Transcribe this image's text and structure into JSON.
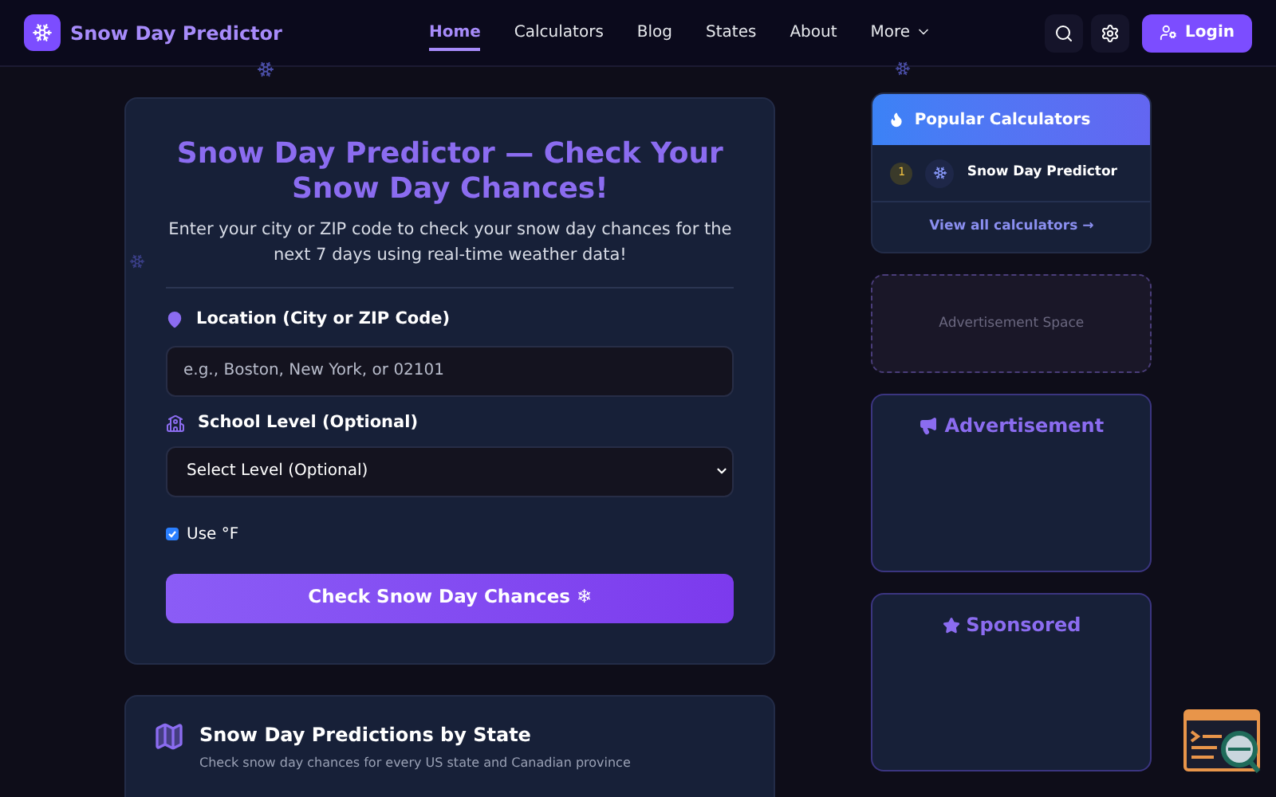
{
  "brand": {
    "name": "Snow Day Predictor"
  },
  "nav": [
    {
      "label": "Home",
      "selected": true
    },
    {
      "label": "Calculators",
      "selected": false
    },
    {
      "label": "Blog",
      "selected": false
    },
    {
      "label": "States",
      "selected": false
    },
    {
      "label": "About",
      "selected": false
    },
    {
      "label": "More",
      "selected": false,
      "kind": "dropdown"
    }
  ],
  "login": "Login",
  "form": {
    "title": "Snow Day Predictor — Check Your Snow Day Chances!",
    "subtitle": "Enter your city or ZIP code to check your snow day chances for the next 7 days using real-time weather data!",
    "location_label": "Location (City or ZIP Code)",
    "location_placeholder": "e.g., Boston, New York, or 02101",
    "level_label": "School Level (Optional)",
    "level_value": "Select Level (Optional)",
    "unit": {
      "label": "Use °F",
      "checked": true
    },
    "submit": "Check Snow Day Chances ❄"
  },
  "states_section": {
    "title": "Snow Day Predictions by State",
    "subtitle": "Check snow day chances for every US state and Canadian province"
  },
  "popular": {
    "title": "Popular Calculators",
    "items": [
      {
        "rank": "1",
        "name": "Snow Day Predictor"
      }
    ],
    "link": "View all calculators →"
  },
  "ad_space": "Advertisement Space",
  "ad_card": {
    "title": "Advertisement"
  },
  "sponsored": {
    "title": "Sponsored"
  }
}
